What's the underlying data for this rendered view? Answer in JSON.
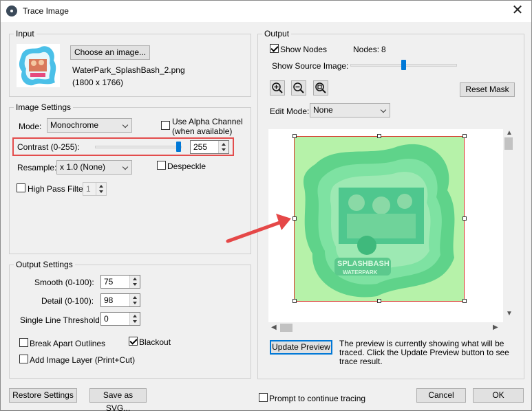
{
  "window": {
    "title": "Trace Image",
    "close_glyph": "✕"
  },
  "input": {
    "group_label": "Input",
    "choose_button": "Choose an image...",
    "file_name": "WaterPark_SplashBash_2.png",
    "dimensions": "(1800 x 1766)"
  },
  "image_settings": {
    "group_label": "Image Settings",
    "mode_label": "Mode:",
    "mode_value": "Monochrome",
    "alpha_label_1": "Use Alpha Channel",
    "alpha_label_2": "(when available)",
    "contrast_label": "Contrast (0-255):",
    "contrast_value": "255",
    "contrast_level": 255,
    "resample_label": "Resample:",
    "resample_value": "x 1.0 (None)",
    "despeckle_label": "Despeckle",
    "high_pass_label": "High Pass Filter",
    "high_pass_value": "1"
  },
  "output_settings": {
    "group_label": "Output Settings",
    "smooth_label": "Smooth (0-100):",
    "smooth_value": "75",
    "detail_label": "Detail (0-100):",
    "detail_value": "98",
    "single_line_label": "Single Line Threshold:",
    "single_line_value": "0",
    "break_apart_label": "Break Apart Outlines",
    "blackout_label": "Blackout",
    "add_layer_label": "Add Image Layer (Print+Cut)"
  },
  "output": {
    "group_label": "Output",
    "show_nodes_label": "Show Nodes",
    "nodes_label": "Nodes:",
    "nodes_value": "8",
    "show_source_label": "Show Source Image:",
    "reset_mask_button": "Reset Mask",
    "edit_mode_label": "Edit Mode:",
    "edit_mode_value": "None",
    "update_preview_button": "Update Preview",
    "preview_note_1": "The preview is currently showing what will be",
    "preview_note_2": "traced. Click the Update Preview button to see",
    "preview_note_3": "trace result.",
    "logo_line_1": "SPLASHBASH",
    "logo_line_2": "WATERPARK"
  },
  "footer": {
    "restore_button": "Restore Settings",
    "save_svg_button": "Save as SVG...",
    "prompt_label": "Prompt to continue tracing",
    "cancel_button": "Cancel",
    "ok_button": "OK"
  },
  "colors": {
    "accent": "#0078d7",
    "highlight_box": "#e34c4c",
    "trace_fill": "#b6f2a9",
    "trace_border": "#d9342b"
  },
  "icons": [
    "app-icon",
    "close-icon",
    "zoom-in-icon",
    "zoom-out-icon",
    "zoom-fit-icon",
    "annotation-arrow-icon"
  ]
}
